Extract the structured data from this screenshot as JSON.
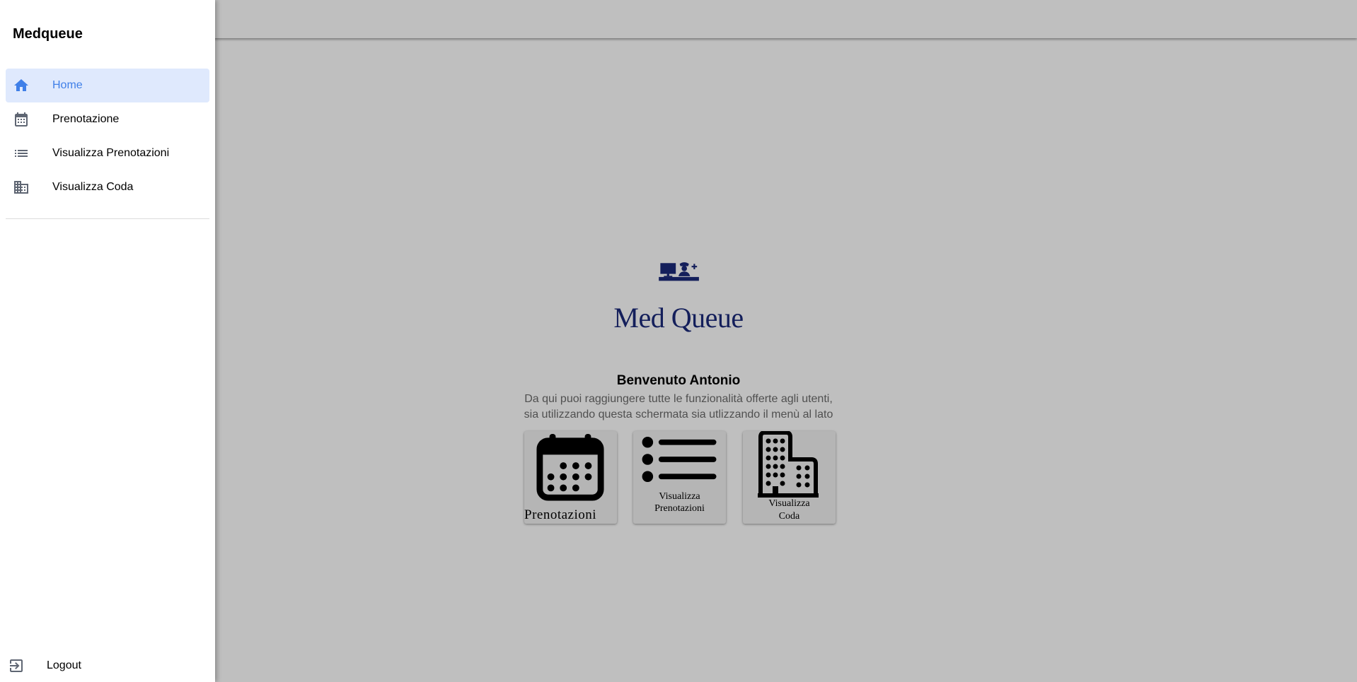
{
  "drawer": {
    "title": "Medqueue",
    "items": [
      {
        "label": "Home",
        "icon": "home-icon",
        "active": true
      },
      {
        "label": "Prenotazione",
        "icon": "calendar-icon",
        "active": false
      },
      {
        "label": "Visualizza Prenotazioni",
        "icon": "list-icon",
        "active": false
      },
      {
        "label": "Visualizza Coda",
        "icon": "building-icon",
        "active": false
      }
    ],
    "logout_label": "Logout"
  },
  "main": {
    "logo_text": "Med Queue",
    "welcome": "Benvenuto Antonio",
    "subtext_line1": "Da qui puoi raggiungere tutte le funzionalità offerte agli utenti,",
    "subtext_line2": "sia utilizzando questa schermata sia utlizzando il menù al lato",
    "cards": [
      {
        "label": "Prenotazioni",
        "icon": "calendar-icon"
      },
      {
        "label_line1": "Visualizza",
        "label_line2": "Prenotazioni",
        "icon": "list-icon"
      },
      {
        "label_line1": "Visualizza",
        "label_line2": "Coda",
        "icon": "building-icon"
      }
    ]
  },
  "colors": {
    "accent": "#3f7fe8",
    "active_bg": "#dfe9fd",
    "logo": "#1b2a7a",
    "nav_icon": "#5f6673"
  }
}
